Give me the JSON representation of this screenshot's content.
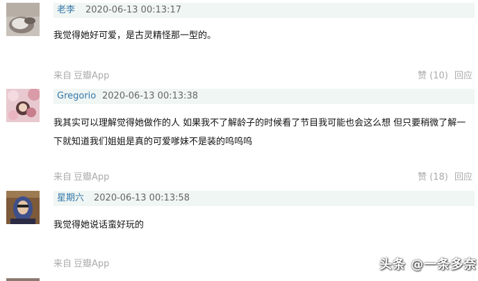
{
  "comments": [
    {
      "author": "老李",
      "time": "2020-06-13 00:13:17",
      "content": "我觉得她好可爱，是古灵精怪那一型的。",
      "from_label": "来自",
      "source": "豆瓣App",
      "vote": "赞 (10)",
      "reply": "回应"
    },
    {
      "author": "Gregorio",
      "time": "2020-06-13 00:13:38",
      "content": "我其实可以理解觉得她做作的人 如果我不了解龄子的时候看了节目我可能也会这么想 但只要稍微了解一下就知道我们姐姐是真的可爱嗲妹不是装的呜呜呜",
      "from_label": "来自",
      "source": "豆瓣App",
      "vote": "赞 (18)",
      "reply": "回应"
    },
    {
      "author": "星期六",
      "time": "2020-06-13 00:13:58",
      "content": "我觉得她说话蛮好玩的",
      "from_label": "来自",
      "source": "豆瓣App",
      "vote": "",
      "reply": ""
    }
  ],
  "watermark": "头条 @一条多奈",
  "colors": {
    "header_bg": "#f0f6f3",
    "author": "#3377aa",
    "meta": "#aaaaaa"
  }
}
